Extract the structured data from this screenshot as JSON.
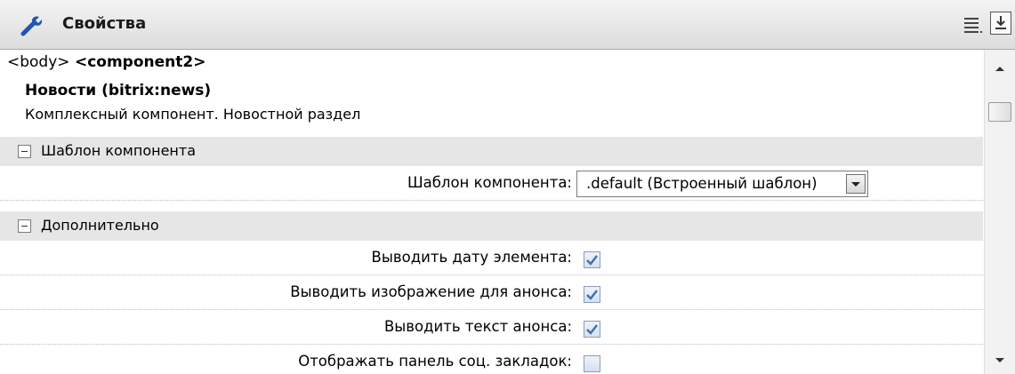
{
  "header": {
    "title": "Свойства",
    "icons": [
      "wrench-icon",
      "list-menu-icon",
      "dock-down-icon"
    ]
  },
  "breadcrumb": {
    "parent": "<body>",
    "current": "<component2>"
  },
  "component": {
    "name": "Новости (bitrix:news)",
    "description": "Комплексный компонент. Новостной раздел"
  },
  "sections": [
    {
      "label": "Шаблон компонента",
      "rows": [
        {
          "label": "Шаблон компонента:",
          "type": "select",
          "value": ".default (Встроенный шаблон)"
        }
      ]
    },
    {
      "label": "Дополнительно",
      "rows": [
        {
          "label": "Выводить дату элемента:",
          "type": "checkbox",
          "checked": true
        },
        {
          "label": "Выводить изображение для анонса:",
          "type": "checkbox",
          "checked": true
        },
        {
          "label": "Выводить текст анонса:",
          "type": "checkbox",
          "checked": true
        },
        {
          "label": "Отображать панель соц. закладок:",
          "type": "checkbox",
          "checked": false
        }
      ]
    }
  ],
  "colors": {
    "header_bg": "#dcdcdc",
    "section_bg": "#e6e6e6",
    "check_mark": "#3a6fb5"
  }
}
